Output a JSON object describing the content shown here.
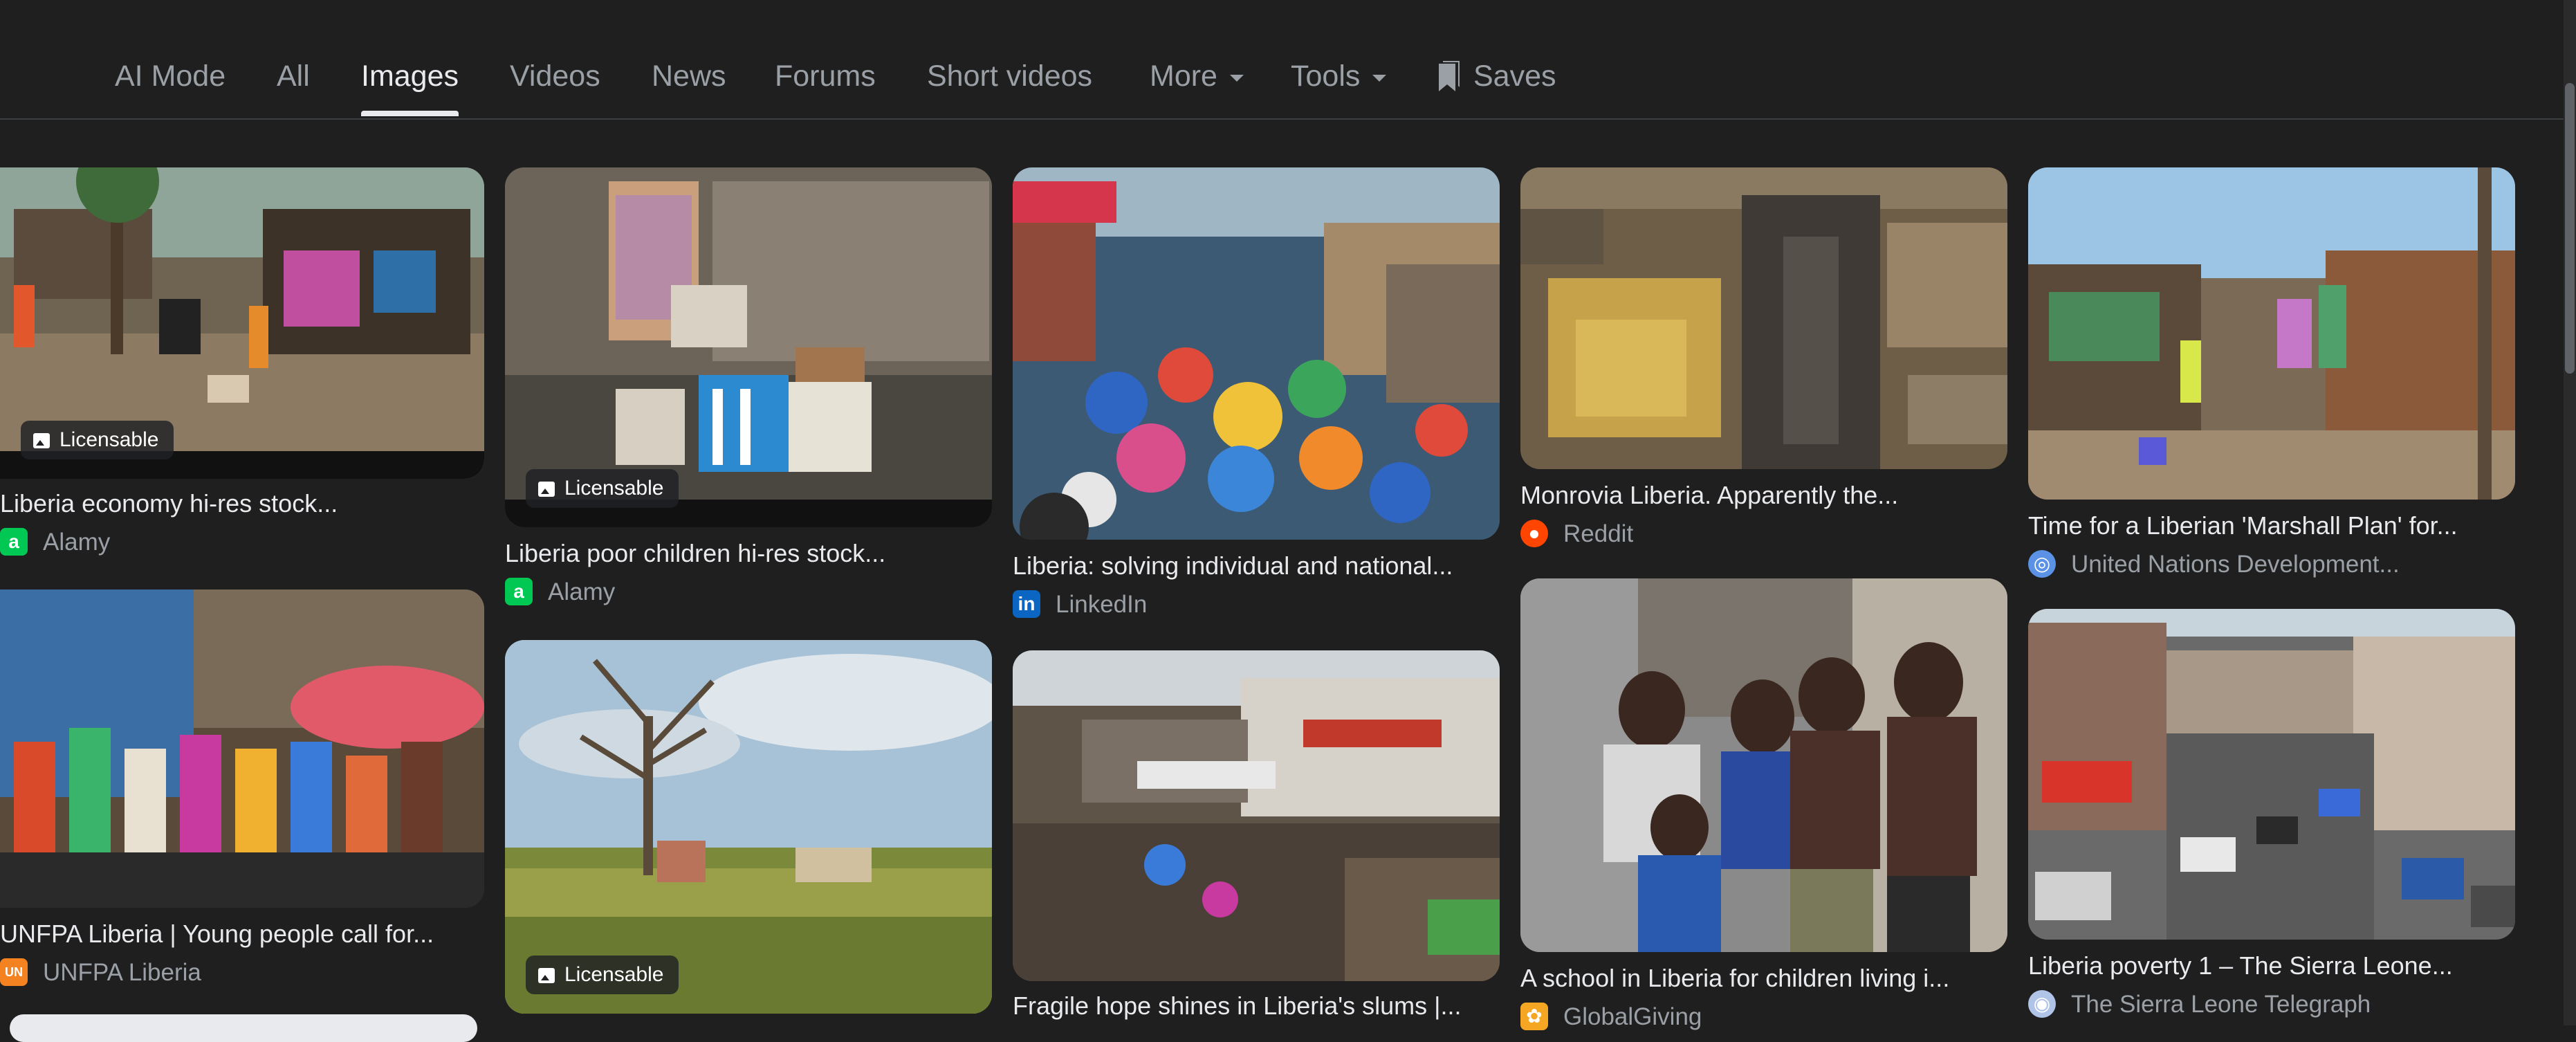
{
  "tabs": [
    {
      "label": "AI Mode"
    },
    {
      "label": "All"
    },
    {
      "label": "Images",
      "active": true
    },
    {
      "label": "Videos"
    },
    {
      "label": "News"
    },
    {
      "label": "Forums"
    },
    {
      "label": "Short videos"
    },
    {
      "label": "More",
      "has_dropdown": true
    },
    {
      "label": "Tools",
      "has_dropdown": true
    },
    {
      "label": "Saves",
      "icon": "bookmark-icon"
    }
  ],
  "badge_label": "Licensable",
  "results": [
    {
      "title": "Liberia economy hi-res stock...",
      "source": "Alamy",
      "favicon": "alamy-icon",
      "licensable": true
    },
    {
      "title": "Liberia poor children hi-res stock...",
      "source": "Alamy",
      "favicon": "alamy-icon",
      "licensable": true
    },
    {
      "title": "Liberia: solving individual and national...",
      "source": "LinkedIn",
      "favicon": "linkedin-icon",
      "licensable": false
    },
    {
      "title": "Monrovia Liberia. Apparently the...",
      "source": "Reddit",
      "favicon": "reddit-icon",
      "licensable": false
    },
    {
      "title": "Time for a Liberian 'Marshall Plan' for...",
      "source": "United Nations Development...",
      "favicon": "un-icon",
      "licensable": false
    },
    {
      "title": "UNFPA Liberia | Young people call for...",
      "source": "UNFPA Liberia",
      "favicon": "unfpa-icon",
      "licensable": false
    },
    {
      "title": "",
      "source": "",
      "favicon": "",
      "licensable": true
    },
    {
      "title": "Fragile hope shines in Liberia's slums |...",
      "source": "",
      "favicon": "",
      "licensable": false
    },
    {
      "title": "A school in Liberia for children living i...",
      "source": "GlobalGiving",
      "favicon": "globalgiving-icon",
      "licensable": false
    },
    {
      "title": "Liberia poverty 1 – The Sierra Leone...",
      "source": "The Sierra Leone Telegraph",
      "favicon": "sierra-leone-telegraph-icon",
      "licensable": false
    }
  ],
  "colors": {
    "background": "#1f1f1f",
    "text_primary": "#e8eaed",
    "text_secondary": "#9aa0a6",
    "alamy": "#00c853",
    "linkedin": "#0a66c2",
    "reddit": "#ff4500",
    "un": "#5b92e5",
    "unfpa": "#f58220",
    "globalgiving": "#f5a623"
  }
}
